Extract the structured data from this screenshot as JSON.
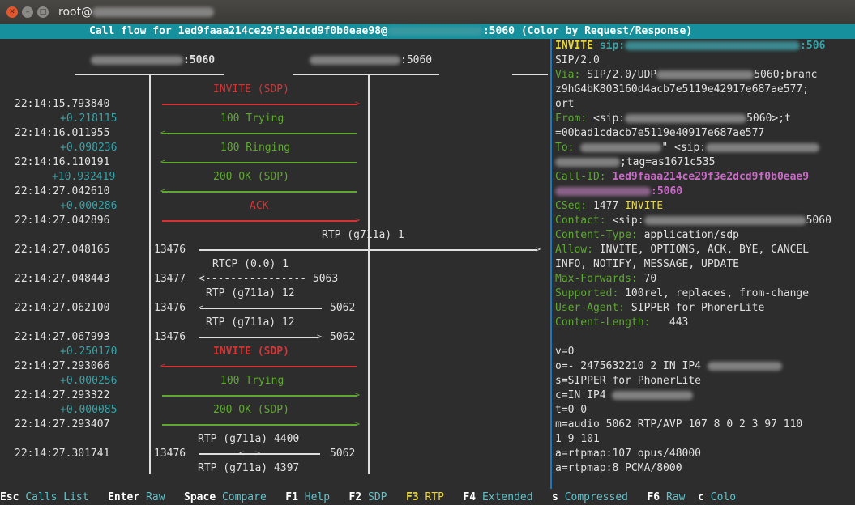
{
  "window": {
    "title_prefix": "root@"
  },
  "header": {
    "prefix": "Call flow for ",
    "callid": "1ed9faaa214ce29f3e2dcd9f0b0eae98@",
    "port_suffix": ":5060",
    "mode": " (Color by Request/Response)"
  },
  "columns": {
    "left_port": ":5060",
    "right_port": ":5060"
  },
  "flow": [
    {
      "label": "INVITE (SDP)",
      "ts": "22:14:15.793840"
    },
    {
      "delta": "+0.218115",
      "label": "100 Trying",
      "ts": "22:14:16.011955"
    },
    {
      "delta": "+0.098236",
      "label": "180 Ringing",
      "ts": "22:14:16.110191"
    },
    {
      "delta": "+10.932419",
      "label": "200 OK (SDP)",
      "ts": "22:14:27.042610"
    },
    {
      "delta": "+0.000286",
      "label": "ACK",
      "ts": "22:14:27.042896"
    }
  ],
  "rtp": [
    {
      "label": "RTP (g711a) 1",
      "ts": "22:14:27.048165",
      "lport": "13476"
    },
    {
      "label": "RTCP (0.0) 1",
      "ts": "22:14:27.048443",
      "lport": "13477",
      "dashes": "<---------------- 5063"
    },
    {
      "label": "RTP (g711a) 12",
      "ts": "22:14:27.062100",
      "lport": "13476",
      "rport": "5062"
    },
    {
      "label": "RTP (g711a) 12",
      "ts": "22:14:27.067993",
      "lport": "13476",
      "rport": "5062"
    }
  ],
  "flow2": [
    {
      "delta": "+0.250170",
      "label": "INVITE (SDP)",
      "ts": "22:14:27.293066"
    },
    {
      "delta": "+0.000256",
      "label": "100 Trying",
      "ts": "22:14:27.293322"
    },
    {
      "delta": "+0.000085",
      "label": "200 OK (SDP)",
      "ts": "22:14:27.293407"
    }
  ],
  "rtp_last": {
    "label_top": "RTP (g711a) 4400",
    "ts": "22:14:27.301741",
    "lport": "13476",
    "rport": "5062",
    "label_bottom": "RTP (g711a) 4397"
  },
  "sip": {
    "invite_method": "INVITE",
    "invite_sip": " sip:",
    "invite_port": ":506",
    "version": "SIP/2.0",
    "via_label": "Via:",
    "via_value": " SIP/2.0/UDP",
    "via_port": "5060;branc",
    "via_branch": "z9hG4bK803160d4acb7e5119e42917e687ae577;",
    "via_rest": "ort",
    "from_label": "From:",
    "from_value": " <sip:",
    "from_port": "5060>;t",
    "from_tag": "=00bad1cdacb7e5119e40917e687ae577",
    "to_label": "To:",
    "to_quote": "\"",
    "to_sip": " <sip:",
    "to_tag": ";tag=as1671c535",
    "callid_label": "Call-ID:",
    "callid_value": " 1ed9faaa214ce29f3e2dcd9f0b0eae9",
    "callid_port": ":5060",
    "cseq_label": "CSeq:",
    "cseq_num": " 1477 ",
    "cseq_method": "INVITE",
    "contact_label": "Contact:",
    "contact_value": " <sip:",
    "contact_port": "5060",
    "ctype_label": "Content-Type:",
    "ctype_value": " application/sdp",
    "allow_label": "Allow:",
    "allow_value": " INVITE, OPTIONS, ACK, BYE, CANCEL",
    "allow_value2": "INFO, NOTIFY, MESSAGE, UPDATE",
    "maxfwd_label": "Max-Forwards:",
    "maxfwd_value": " 70",
    "supported_label": "Supported:",
    "supported_value": " 100rel, replaces, from-change",
    "ua_label": "User-Agent:",
    "ua_value": " SIPPER for PhonerLite",
    "clen_label": "Content-Length:",
    "clen_value": "   443"
  },
  "sdp": [
    "v=0",
    "o=- 2475632210 2 IN IP4",
    "s=SIPPER for PhonerLite",
    "c=IN IP4",
    "t=0 0",
    "m=audio 5062 RTP/AVP 107 8 0 2 3 97 110",
    "1 9 101",
    "a=rtpmap:107 opus/48000",
    "a=rtpmap:8 PCMA/8000"
  ],
  "footer": [
    {
      "key": "Esc",
      "action": "Calls List"
    },
    {
      "key": "Enter",
      "action": "Raw"
    },
    {
      "key": "Space",
      "action": "Compare"
    },
    {
      "key": "F1",
      "action": "Help"
    },
    {
      "key": "F2",
      "action": "SDP"
    },
    {
      "key": "F3",
      "action": "RTP"
    },
    {
      "key": "F4",
      "action": "Extended"
    },
    {
      "key": "s",
      "action": "Compressed"
    },
    {
      "key": "F6",
      "action": "Raw"
    },
    {
      "key": "c",
      "action": "Colo"
    }
  ],
  "colors": {
    "header_bg": "#16909c",
    "green": "#5da82f",
    "red": "#d63333",
    "cyan": "#36a3a8",
    "yellow": "#e7d43d",
    "magenta": "#c86bc6",
    "separator": "#1e78b5"
  }
}
